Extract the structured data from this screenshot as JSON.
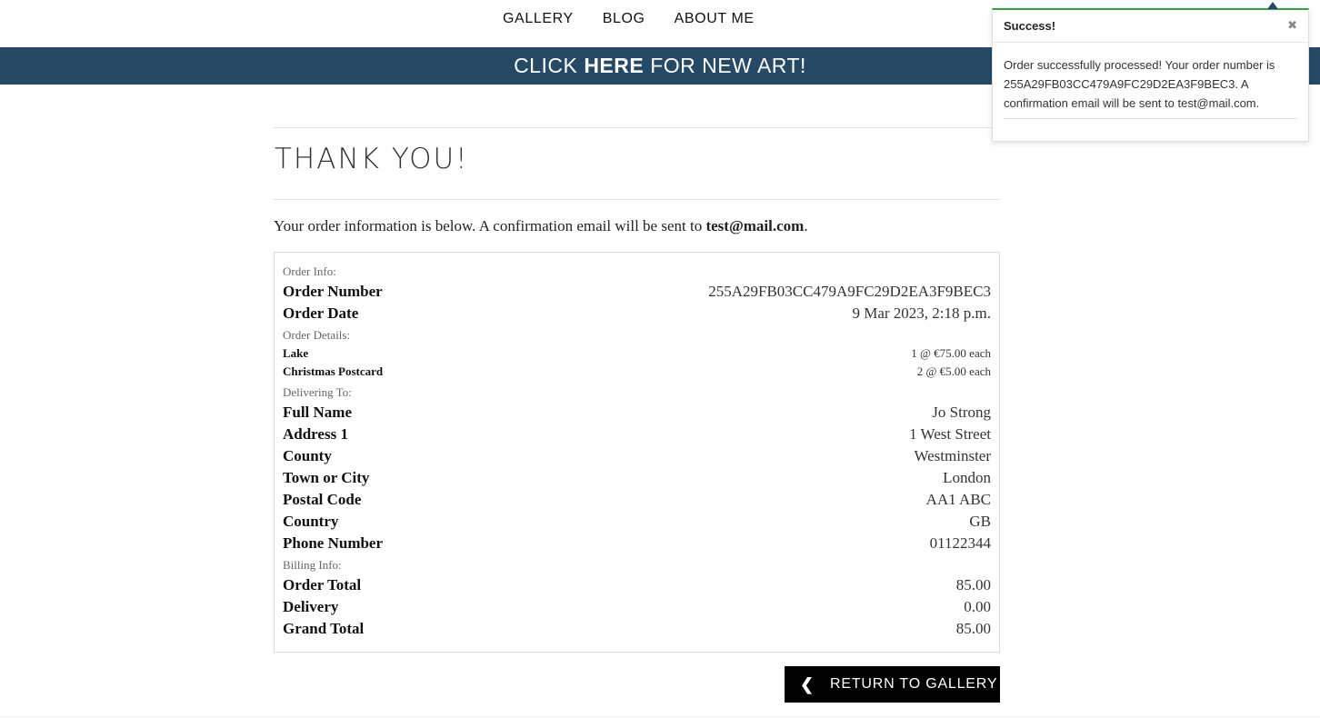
{
  "nav": {
    "links": [
      "GALLERY",
      "BLOG",
      "ABOUT ME"
    ]
  },
  "banner": {
    "prefix": "CLICK",
    "link": "HERE",
    "suffix": "FOR NEW ART!"
  },
  "page": {
    "title": "THANK YOU!",
    "intro_text": "Your order information is below. A confirmation email will be sent to ",
    "email": "test@mail.com",
    "intro_end": "."
  },
  "order_info": {
    "label": "Order Info:",
    "rows": [
      {
        "key": "Order Number",
        "value": "255A29FB03CC479A9FC29D2EA3F9BEC3"
      },
      {
        "key": "Order Date",
        "value": "9 Mar 2023, 2:18 p.m."
      }
    ]
  },
  "order_details": {
    "label": "Order Details:",
    "items": [
      {
        "name": "Lake",
        "qty_price": "1 @ €75.00 each"
      },
      {
        "name": "Christmas Postcard",
        "qty_price": "2 @ €5.00 each"
      }
    ]
  },
  "delivering_to": {
    "label": "Delivering To:",
    "rows": [
      {
        "key": "Full Name",
        "value": "Jo Strong"
      },
      {
        "key": "Address 1",
        "value": "1 West Street"
      },
      {
        "key": "County",
        "value": "Westminster"
      },
      {
        "key": "Town or City",
        "value": "London"
      },
      {
        "key": "Postal Code",
        "value": "AA1 ABC"
      },
      {
        "key": "Country",
        "value": "GB"
      },
      {
        "key": "Phone Number",
        "value": "01122344"
      }
    ]
  },
  "billing_info": {
    "label": "Billing Info:",
    "rows": [
      {
        "key": "Order Total",
        "value": "85.00"
      },
      {
        "key": "Delivery",
        "value": "0.00"
      },
      {
        "key": "Grand Total",
        "value": "85.00"
      }
    ]
  },
  "return_button": {
    "icon": "chevron-left-icon",
    "label": "RETURN TO GALLERY"
  },
  "toast": {
    "title": "Success!",
    "message": "Order successfully processed! Your order number is 255A29FB03CC479A9FC29D2EA3F9BEC3. A confirmation email will be sent to test@mail.com.",
    "close_icon": "close-icon",
    "accent_color": "#3c9e4a"
  },
  "colors": {
    "banner": "#264a66",
    "button": "#000000"
  }
}
